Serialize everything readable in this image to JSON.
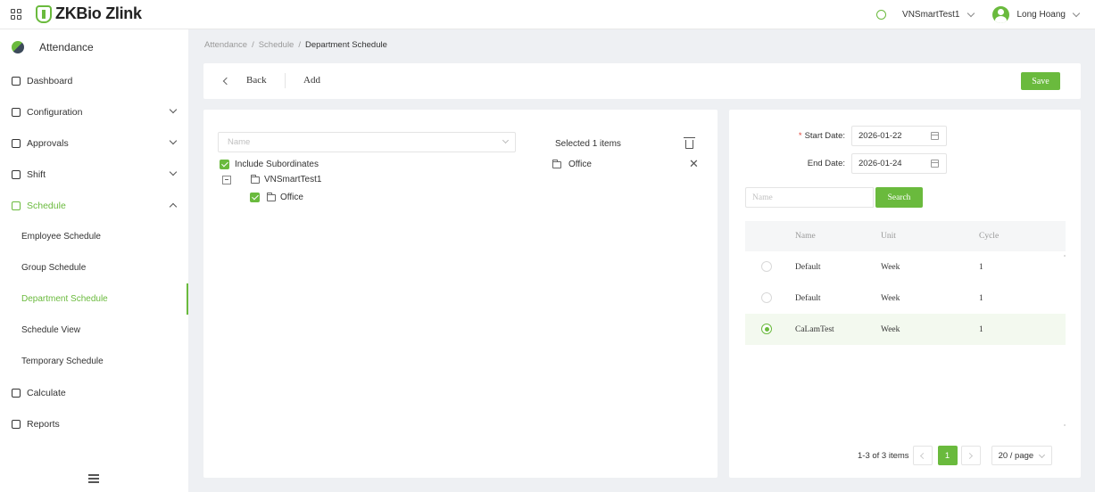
{
  "header": {
    "logo_text": "ZKBio Zlink",
    "site_name": "VNSmartTest1",
    "user_name": "Long Hoang"
  },
  "sidebar": {
    "module_title": "Attendance",
    "items": [
      {
        "label": "Dashboard",
        "icon": "dashboard-icon"
      },
      {
        "label": "Configuration",
        "icon": "configuration-icon",
        "has_children": true
      },
      {
        "label": "Approvals",
        "icon": "approvals-icon",
        "has_children": true
      },
      {
        "label": "Shift",
        "icon": "shift-icon",
        "has_children": true
      },
      {
        "label": "Schedule",
        "icon": "schedule-icon",
        "has_children": true,
        "expanded": true,
        "active": true
      },
      {
        "label": "Calculate",
        "icon": "calculate-icon"
      },
      {
        "label": "Reports",
        "icon": "reports-icon"
      }
    ],
    "schedule_children": [
      {
        "label": "Employee Schedule"
      },
      {
        "label": "Group Schedule"
      },
      {
        "label": "Department Schedule",
        "current": true
      },
      {
        "label": "Schedule View"
      },
      {
        "label": "Temporary Schedule"
      }
    ]
  },
  "breadcrumb": [
    "Attendance",
    "Schedule",
    "Department Schedule"
  ],
  "toolbar": {
    "back_label": "Back",
    "add_label": "Add",
    "save_label": "Save"
  },
  "department_picker": {
    "name_placeholder": "Name",
    "include_subordinates_label": "Include Subordinates",
    "include_subordinates_checked": true,
    "tree": [
      {
        "label": "VNSmartTest1",
        "expanded": true,
        "children": [
          {
            "label": "Office",
            "checked": true
          }
        ]
      }
    ],
    "selected_title": "Selected 1 items",
    "selected_items": [
      "Office"
    ]
  },
  "schedule_form": {
    "start_date_label": "Start Date:",
    "start_date_value": "2026-01-22",
    "end_date_label": "End Date:",
    "end_date_value": "2026-01-24",
    "search_placeholder": "Name",
    "search_label": "Search",
    "columns": [
      "Name",
      "Unit",
      "Cycle"
    ],
    "rows": [
      {
        "name": "Default",
        "unit": "Week",
        "cycle": "1",
        "selected": false
      },
      {
        "name": "Default",
        "unit": "Week",
        "cycle": "1",
        "selected": false
      },
      {
        "name": "CaLamTest",
        "unit": "Week",
        "cycle": "1",
        "selected": true
      }
    ],
    "pagination": {
      "summary": "1-3 of 3 items",
      "current_page": "1",
      "page_size": "20 / page"
    }
  },
  "colors": {
    "accent": "#6aba3d",
    "required": "#e0463a"
  }
}
